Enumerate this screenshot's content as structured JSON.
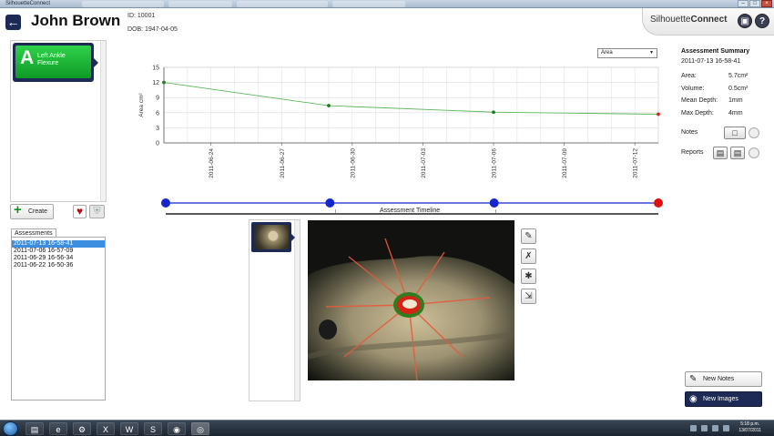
{
  "window": {
    "title": "SilhouetteConnect"
  },
  "patient": {
    "name": "John Brown",
    "id": "ID: 10001",
    "dob": "DOB: 1947-04-05"
  },
  "brand": {
    "part1": "Silhouette",
    "part2": "Connect"
  },
  "wound": {
    "letter": "A",
    "label": "Left Ankle Flexure"
  },
  "buttons": {
    "create": "Create",
    "new_notes": "New Notes",
    "new_images": "New Images"
  },
  "assessments": {
    "tab_label": "Assessments",
    "items": [
      "2011-07-13 16-58-41",
      "2011-07-06 16-57-09",
      "2011-06-29 16-56-34",
      "2011-06-22 16-50-36"
    ],
    "selected_index": 0
  },
  "metric_select": {
    "value": "Area"
  },
  "timeline": {
    "label": "Assessment Timeline"
  },
  "summary": {
    "title": "Assessment Summary",
    "date": "2011-07-13 16-58-41",
    "rows": [
      {
        "label": "Area:",
        "value": "5.7cm²"
      },
      {
        "label": "Volume:",
        "value": "0.5cm³"
      },
      {
        "label": "Mean Depth:",
        "value": "1mm"
      },
      {
        "label": "Max Depth:",
        "value": "4mm"
      }
    ],
    "notes_label": "Notes",
    "reports_label": "Reports"
  },
  "colors": {
    "navy": "#1d2a55",
    "accent_green": "#1c8a2a",
    "line_green": "#5cb85c",
    "point_red": "#d9251c",
    "timeline_blue": "#1326c9"
  },
  "chart_data": {
    "type": "line",
    "ylabel": "Area cm²",
    "xlabel": "",
    "title": "",
    "ylim": [
      0,
      15
    ],
    "yticks": [
      0,
      3,
      6,
      9,
      12,
      15
    ],
    "xlim": [
      "2011-06-22",
      "2011-07-13"
    ],
    "xticks": [
      "2011-06-24",
      "2011-06-27",
      "2011-06-30",
      "2011-07-03",
      "2011-07-06",
      "2011-07-09",
      "2011-07-12"
    ],
    "grid": true,
    "series": [
      {
        "points": [
          {
            "x": "2011-06-22",
            "y": 12
          },
          {
            "x": "2011-06-29",
            "y": 7.4
          },
          {
            "x": "2011-07-06",
            "y": 6.1
          },
          {
            "x": "2011-07-13",
            "y": 5.7
          }
        ]
      }
    ]
  },
  "taskbar": {
    "time": "5:18 p.m.",
    "date": "13/07/2011"
  }
}
